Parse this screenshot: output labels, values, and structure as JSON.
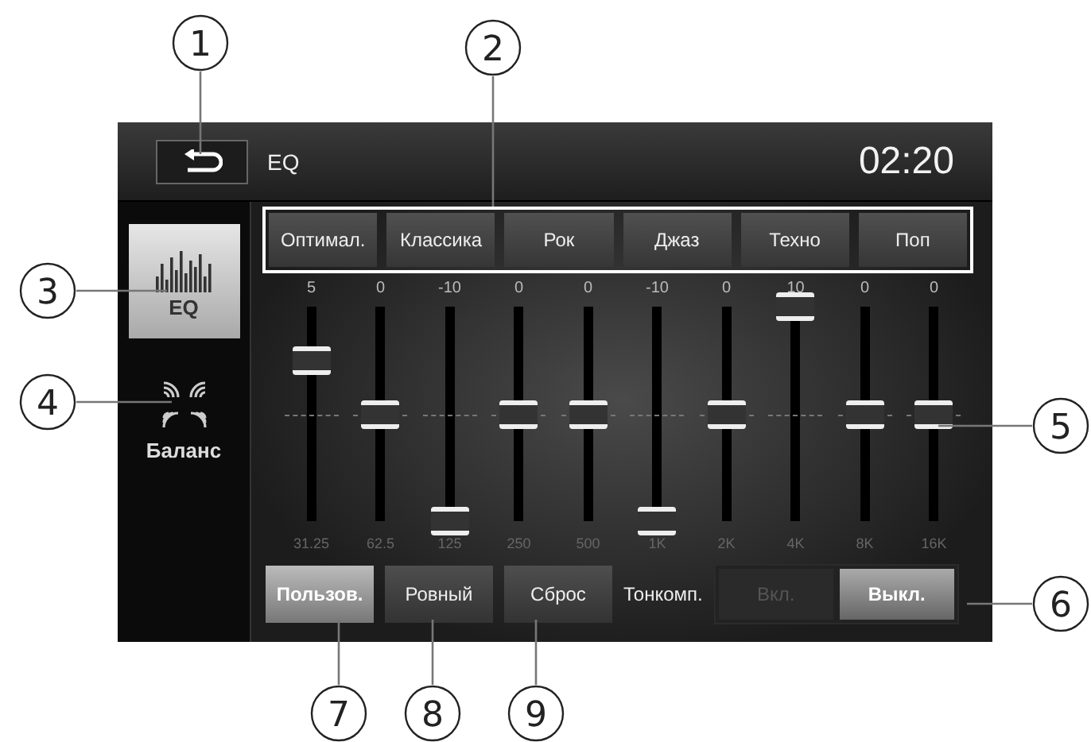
{
  "top_bar": {
    "title": "EQ",
    "time": "02:20"
  },
  "sidebar": [
    {
      "kind": "eq",
      "label": "EQ",
      "selected": true
    },
    {
      "kind": "balance",
      "label": "Баланс",
      "selected": false
    }
  ],
  "presets": [
    {
      "label": "Оптимал.",
      "selected": false
    },
    {
      "label": "Классика",
      "selected": false
    },
    {
      "label": "Рок",
      "selected": false
    },
    {
      "label": "Джаз",
      "selected": false
    },
    {
      "label": "Техно",
      "selected": false
    },
    {
      "label": "Поп",
      "selected": false
    }
  ],
  "bands": [
    {
      "value": "5",
      "freq": "31.25",
      "level": 0.75
    },
    {
      "value": "0",
      "freq": "62.5",
      "level": 0.5
    },
    {
      "value": "-10",
      "freq": "125",
      "level": 0
    },
    {
      "value": "0",
      "freq": "250",
      "level": 0.5
    },
    {
      "value": "0",
      "freq": "500",
      "level": 0.5
    },
    {
      "value": "-10",
      "freq": "1K",
      "level": 0
    },
    {
      "value": "0",
      "freq": "2K",
      "level": 0.5
    },
    {
      "value": "10",
      "freq": "4K",
      "level": 1
    },
    {
      "value": "0",
      "freq": "8K",
      "level": 0.5
    },
    {
      "value": "0",
      "freq": "16K",
      "level": 0.5
    }
  ],
  "bottom_buttons": [
    {
      "label": "Пользов.",
      "selected": true
    },
    {
      "label": "Ровный",
      "selected": false
    },
    {
      "label": "Сброс",
      "selected": false
    }
  ],
  "loudness": {
    "label": "Тонкомп.",
    "options": [
      {
        "label": "Вкл.",
        "selected": false
      },
      {
        "label": "Выкл.",
        "selected": true
      }
    ]
  },
  "callouts": [
    "1",
    "2",
    "3",
    "4",
    "5",
    "6",
    "7",
    "8",
    "9"
  ]
}
